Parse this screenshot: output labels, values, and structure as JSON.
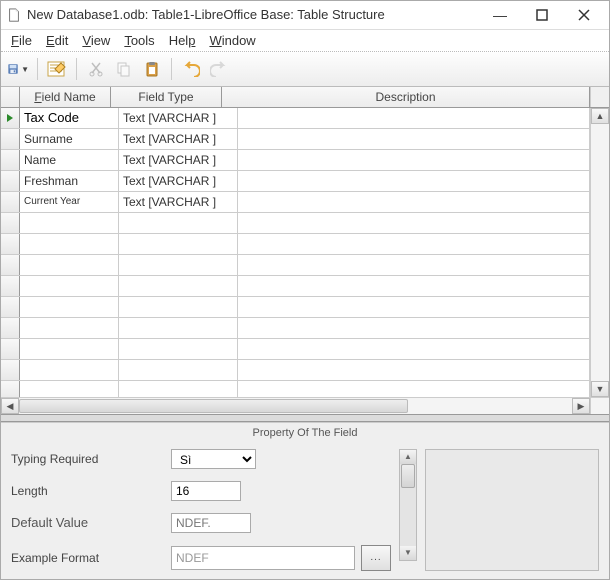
{
  "window": {
    "title": "New Database1.odb: Table1-LibreOffice Base: Table Structure"
  },
  "menu": {
    "file": "File",
    "edit": "Edit",
    "view": "View",
    "tools": "Tools",
    "help": "Help",
    "window": "Window"
  },
  "grid": {
    "headers": {
      "name": "Field Name",
      "type": "Field Type",
      "desc": "Description"
    },
    "rows": [
      {
        "name": "Tax Code",
        "type": "Text [VARCHAR ]",
        "desc": ""
      },
      {
        "name": "Surname",
        "type": "Text [VARCHAR ]",
        "desc": ""
      },
      {
        "name": "Name",
        "type": "Text [VARCHAR ]",
        "desc": ""
      },
      {
        "name": "Freshman",
        "type": "Text [VARCHAR ]",
        "desc": ""
      },
      {
        "name": "Current Year",
        "type": "Text [VARCHAR ]",
        "desc": ""
      },
      {
        "name": "",
        "type": "",
        "desc": ""
      },
      {
        "name": "",
        "type": "",
        "desc": ""
      },
      {
        "name": "",
        "type": "",
        "desc": ""
      },
      {
        "name": "",
        "type": "",
        "desc": ""
      },
      {
        "name": "",
        "type": "",
        "desc": ""
      },
      {
        "name": "",
        "type": "",
        "desc": ""
      },
      {
        "name": "",
        "type": "",
        "desc": ""
      },
      {
        "name": "",
        "type": "",
        "desc": ""
      },
      {
        "name": "",
        "type": "",
        "desc": ""
      }
    ]
  },
  "properties": {
    "title": "Property Of The Field",
    "typing_label": "Typing Required",
    "typing_value": "Sì",
    "length_label": "Length",
    "length_value": "16",
    "default_label": "Default Value",
    "default_value": "NDEF.",
    "format_label": "Example Format",
    "format_value": "NDEF",
    "format_button": "..."
  }
}
